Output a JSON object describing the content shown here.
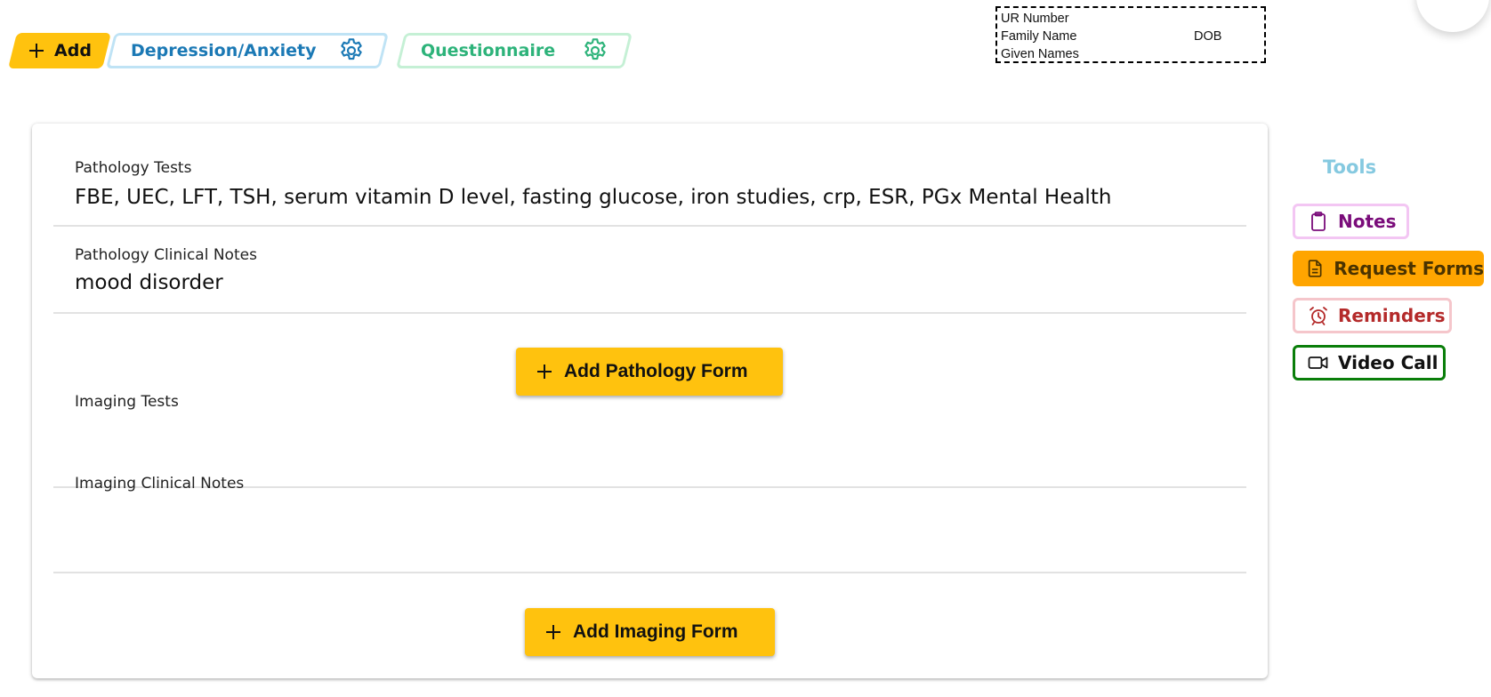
{
  "tabs": {
    "add": {
      "label": "Add",
      "icon": "plus-icon"
    },
    "items": [
      {
        "label": "Depression/Anxiety",
        "icon": "gear-icon",
        "color": "#1B79B5",
        "border": "#BFE3F5"
      },
      {
        "label": "Questionnaire",
        "icon": "gear-icon",
        "color": "#2DB37A",
        "border": "#C5F0D5"
      }
    ]
  },
  "patient_label": {
    "ur_number": "UR Number",
    "family_name": "Family Name",
    "dob": "DOB",
    "given_names": "Given Names"
  },
  "form": {
    "pathology_tests": {
      "label": "Pathology Tests",
      "value": "FBE, UEC, LFT, TSH, serum vitamin D level, fasting glucose, iron studies, crp, ESR, PGx Mental Health"
    },
    "pathology_clinical_notes": {
      "label": "Pathology Clinical Notes",
      "value": "mood disorder"
    },
    "add_pathology_button": "Add Pathology Form",
    "imaging_tests": {
      "label": "Imaging Tests",
      "value": ""
    },
    "imaging_clinical_notes": {
      "label": "Imaging Clinical Notes",
      "value": ""
    },
    "add_imaging_button": "Add Imaging Form"
  },
  "tools": {
    "title": "Tools",
    "items": [
      {
        "label": "Notes",
        "icon": "clipboard-icon",
        "color": "#7A0C7A"
      },
      {
        "label": "Request Forms",
        "icon": "document-icon",
        "color": "#FFA500"
      },
      {
        "label": "Reminders",
        "icon": "alarm-clock-icon",
        "color": "#B42A2A"
      },
      {
        "label": "Video Call",
        "icon": "video-camera-icon",
        "color": "#0A7E0A"
      }
    ]
  },
  "colors": {
    "accent_yellow": "#FFC20E",
    "orange": "#FFA500"
  }
}
